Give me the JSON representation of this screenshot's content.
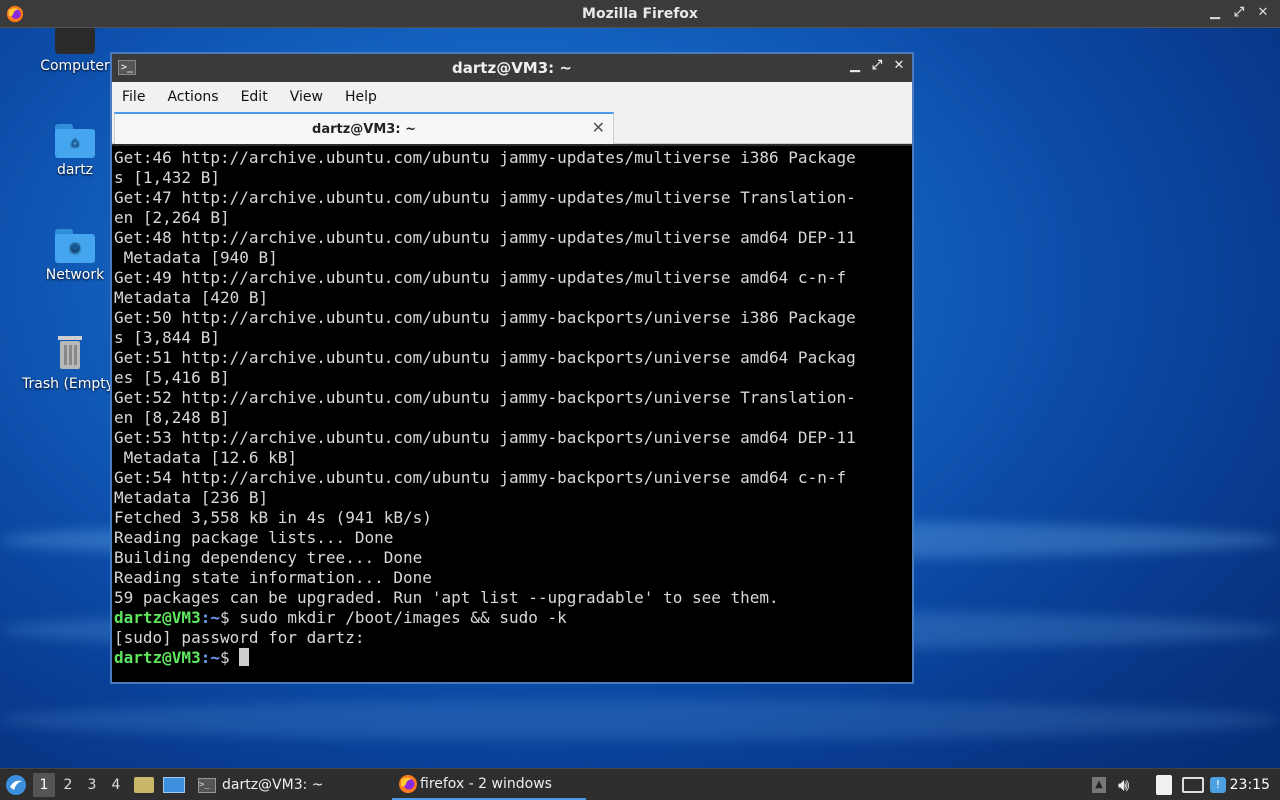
{
  "desktop": {
    "firefox_window_title": "Mozilla Firefox",
    "icons": [
      {
        "label": "Computer"
      },
      {
        "label": "dartz"
      },
      {
        "label": "Network"
      },
      {
        "label": "Trash (Empty)"
      }
    ]
  },
  "terminal": {
    "title": "dartz@VM3: ~",
    "menu": [
      "File",
      "Actions",
      "Edit",
      "View",
      "Help"
    ],
    "tab_label": "dartz@VM3: ~",
    "lines": [
      "Get:46 http://archive.ubuntu.com/ubuntu jammy-updates/multiverse i386 Package",
      "s [1,432 B]",
      "Get:47 http://archive.ubuntu.com/ubuntu jammy-updates/multiverse Translation-",
      "en [2,264 B]",
      "Get:48 http://archive.ubuntu.com/ubuntu jammy-updates/multiverse amd64 DEP-11",
      " Metadata [940 B]",
      "Get:49 http://archive.ubuntu.com/ubuntu jammy-updates/multiverse amd64 c-n-f",
      "Metadata [420 B]",
      "Get:50 http://archive.ubuntu.com/ubuntu jammy-backports/universe i386 Package",
      "s [3,844 B]",
      "Get:51 http://archive.ubuntu.com/ubuntu jammy-backports/universe amd64 Packag",
      "es [5,416 B]",
      "Get:52 http://archive.ubuntu.com/ubuntu jammy-backports/universe Translation-",
      "en [8,248 B]",
      "Get:53 http://archive.ubuntu.com/ubuntu jammy-backports/universe amd64 DEP-11",
      " Metadata [12.6 kB]",
      "Get:54 http://archive.ubuntu.com/ubuntu jammy-backports/universe amd64 c-n-f",
      "Metadata [236 B]",
      "Fetched 3,558 kB in 4s (941 kB/s)",
      "Reading package lists... Done",
      "Building dependency tree... Done",
      "Reading state information... Done",
      "59 packages can be upgraded. Run 'apt list --upgradable' to see them."
    ],
    "prompt_user": "dartz@VM3",
    "prompt_path": ":~",
    "prompt_symbol": "$ ",
    "command": "sudo mkdir /boot/images && sudo -k",
    "sudo_prompt": "[sudo] password for dartz:"
  },
  "taskbar": {
    "workspaces": [
      "1",
      "2",
      "3",
      "4"
    ],
    "tasks": [
      {
        "label": "dartz@VM3: ~"
      },
      {
        "label": "firefox - 2 windows"
      }
    ],
    "clock": "23:15"
  }
}
